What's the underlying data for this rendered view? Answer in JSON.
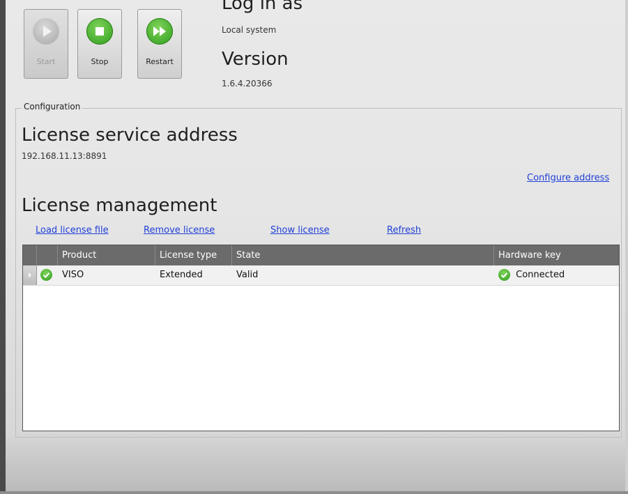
{
  "service": {
    "buttons": [
      {
        "label": "Start",
        "icon": "play-icon",
        "enabled": false
      },
      {
        "label": "Stop",
        "icon": "stop-icon",
        "enabled": true
      },
      {
        "label": "Restart",
        "icon": "fast-forward-icon",
        "enabled": true
      }
    ],
    "login_heading": "Log in as",
    "login_value": "Local system",
    "version_heading": "Version",
    "version_value": "1.6.4.20366"
  },
  "configuration": {
    "group_label": "Configuration",
    "address_heading": "License service address",
    "address_value": "192.168.11.13:8891",
    "configure_link": "Configure address",
    "management_heading": "License management",
    "actions": {
      "load": "Load license file",
      "remove": "Remove license",
      "show": "Show license",
      "refresh": "Refresh"
    }
  },
  "license_table": {
    "columns": [
      "Product",
      "License type",
      "State",
      "Hardware key"
    ],
    "rows": [
      {
        "status_icon": "check-circle-icon",
        "product": "VISO",
        "license_type": "Extended",
        "state": "Valid",
        "hardware_key": "Connected",
        "hardware_icon": "check-circle-icon"
      }
    ]
  },
  "colors": {
    "accent_green": "#2e9c1d",
    "link_blue": "#1f3fd6",
    "header_grey": "#6b6b6b"
  }
}
